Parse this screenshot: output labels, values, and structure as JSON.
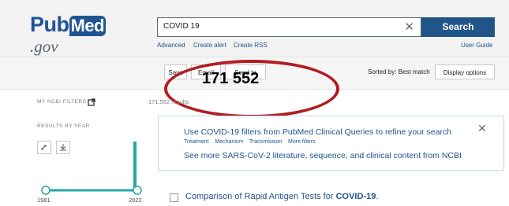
{
  "header": {
    "logo_pub": "Pub",
    "logo_med": "Med",
    "logo_gov": ".gov",
    "search_value": "COVID 19",
    "clear_label": "✕",
    "search_button": "Search",
    "links": {
      "advanced": "Advanced",
      "create_alert": "Create alert",
      "create_rss": "Create RSS",
      "user_guide": "User Guide"
    }
  },
  "toolbar": {
    "save": "Save",
    "email": "Email",
    "send_to": "Send to",
    "sorted_by": "Sorted by: Best match",
    "display_options": "Display options"
  },
  "annotation": {
    "count": "171 552",
    "color": "#b11d20"
  },
  "sidebar": {
    "my_ncbi_filters": "MY NCBI FILTERS",
    "results_by_year": "RESULTS BY YEAR",
    "year_start": "1981",
    "year_end": "2022"
  },
  "results": {
    "count_text": "171,552 results"
  },
  "banner": {
    "line1": "Use COVID-19 filters from PubMed Clinical Queries to refine your search",
    "filters": [
      "Treatment",
      "Mechanism",
      "Transmission",
      "More filters"
    ],
    "line3": "See more SARS-CoV-2 literature, sequence, and clinical content from NCBI",
    "close": "✕"
  },
  "first_result": {
    "title_prefix": "Comparison of Rapid Antigen Tests for ",
    "title_bold": "COVID-19",
    "title_suffix": "."
  },
  "colors": {
    "brand": "#20558a",
    "accent_teal": "#2aa7a3",
    "header_bg": "#f3f3f3"
  }
}
